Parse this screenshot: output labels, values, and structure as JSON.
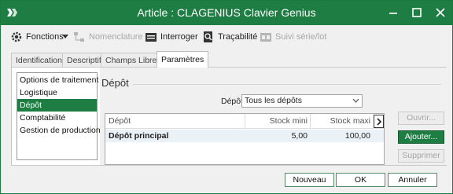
{
  "window": {
    "title": "Article : CLAGENIUS Clavier Genius",
    "accent_color": "#1e7d42"
  },
  "toolbar": {
    "fonctions_label": "Fonctions",
    "nomenclature_label": "Nomenclature",
    "interroger_label": "Interroger",
    "tracabilite_label": "Traçabilité",
    "suivi_label": "Suivi série/lot"
  },
  "tabs": [
    {
      "label": "Identification",
      "active": false
    },
    {
      "label": "Descriptif",
      "active": false
    },
    {
      "label": "Champs Libres",
      "active": false
    },
    {
      "label": "Paramètres",
      "active": true
    }
  ],
  "sidebar": {
    "items": [
      {
        "label": "Options de traitement"
      },
      {
        "label": "Logistique"
      },
      {
        "label": "Dépôt",
        "selected": true
      },
      {
        "label": "Comptabilité"
      },
      {
        "label": "Gestion de production"
      }
    ]
  },
  "depot": {
    "group_title": "Dépôt",
    "filter_label": "Dépôt",
    "filter_value": "Tous les dépôts",
    "columns": [
      "Dépôt",
      "Stock mini",
      "Stock maxi"
    ],
    "rows": [
      {
        "depot": "Dépôt principal",
        "stock_mini": "5,00",
        "stock_maxi": "100,00"
      }
    ],
    "buttons": {
      "ouvrir": "Ouvrir...",
      "ajouter": "Ajouter...",
      "supprimer": "Supprimer"
    }
  },
  "footer": {
    "nouveau": "Nouveau",
    "ok": "OK",
    "annuler": "Annuler"
  }
}
